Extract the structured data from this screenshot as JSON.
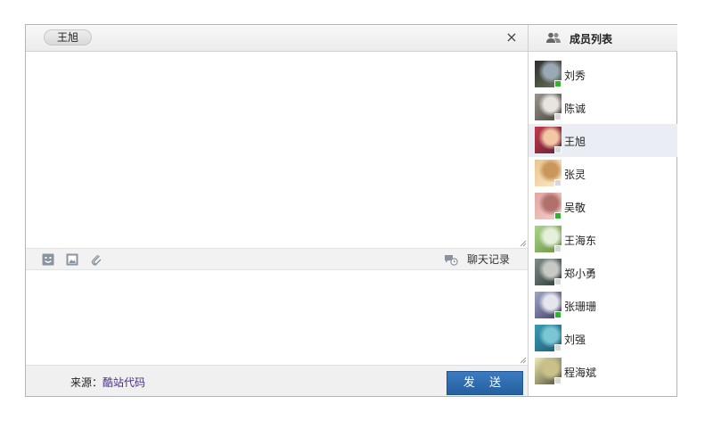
{
  "chat": {
    "contact_name": "王旭",
    "close_glyph": "×",
    "history_label": "聊天记录",
    "source_label": "来源：",
    "source_link": "酷站代码",
    "send_label": "发 送"
  },
  "members": {
    "title": "成员列表",
    "items": [
      {
        "name": "刘秀",
        "status": "online",
        "avatar_colors": [
          "#2c2c2c",
          "#9aa9b5",
          "#6b7b5a"
        ]
      },
      {
        "name": "陈诚",
        "status": "offline",
        "avatar_colors": [
          "#9a958e",
          "#e8e4df",
          "#4a443e"
        ]
      },
      {
        "name": "王旭",
        "status": "offline",
        "avatar_colors": [
          "#c2384a",
          "#f1c7a4",
          "#612236"
        ],
        "active": true
      },
      {
        "name": "张灵",
        "status": "offline",
        "avatar_colors": [
          "#e9c58d",
          "#c9965b",
          "#fbe9cc"
        ]
      },
      {
        "name": "吴敬",
        "status": "online",
        "avatar_colors": [
          "#e3a6a2",
          "#b1706c",
          "#f3cfc7"
        ]
      },
      {
        "name": "王海东",
        "status": "offline",
        "avatar_colors": [
          "#a8d58a",
          "#e6eedc",
          "#6c8f3f"
        ]
      },
      {
        "name": "郑小勇",
        "status": "offline",
        "avatar_colors": [
          "#7c8c8b",
          "#c7c9c2",
          "#2e3a37"
        ]
      },
      {
        "name": "张珊珊",
        "status": "online",
        "avatar_colors": [
          "#9da6c4",
          "#e5e5ed",
          "#3d3c64"
        ]
      },
      {
        "name": "刘强",
        "status": "offline",
        "avatar_colors": [
          "#3a9ab4",
          "#7bc6d4",
          "#1c5b72"
        ]
      },
      {
        "name": "程海斌",
        "status": "offline",
        "avatar_colors": [
          "#f1ebb0",
          "#c9c08a",
          "#4a4a38"
        ]
      }
    ]
  },
  "colors": {
    "accent": "#2a6aae",
    "online": "#2db52d",
    "offline": "#d8d8d8",
    "active_row": "#eaedf3"
  },
  "icons": {
    "emoji": "emoji-icon",
    "image": "image-icon",
    "attach": "paperclip-icon",
    "history": "chat-history-icon",
    "members": "people-icon",
    "close": "close-icon"
  }
}
